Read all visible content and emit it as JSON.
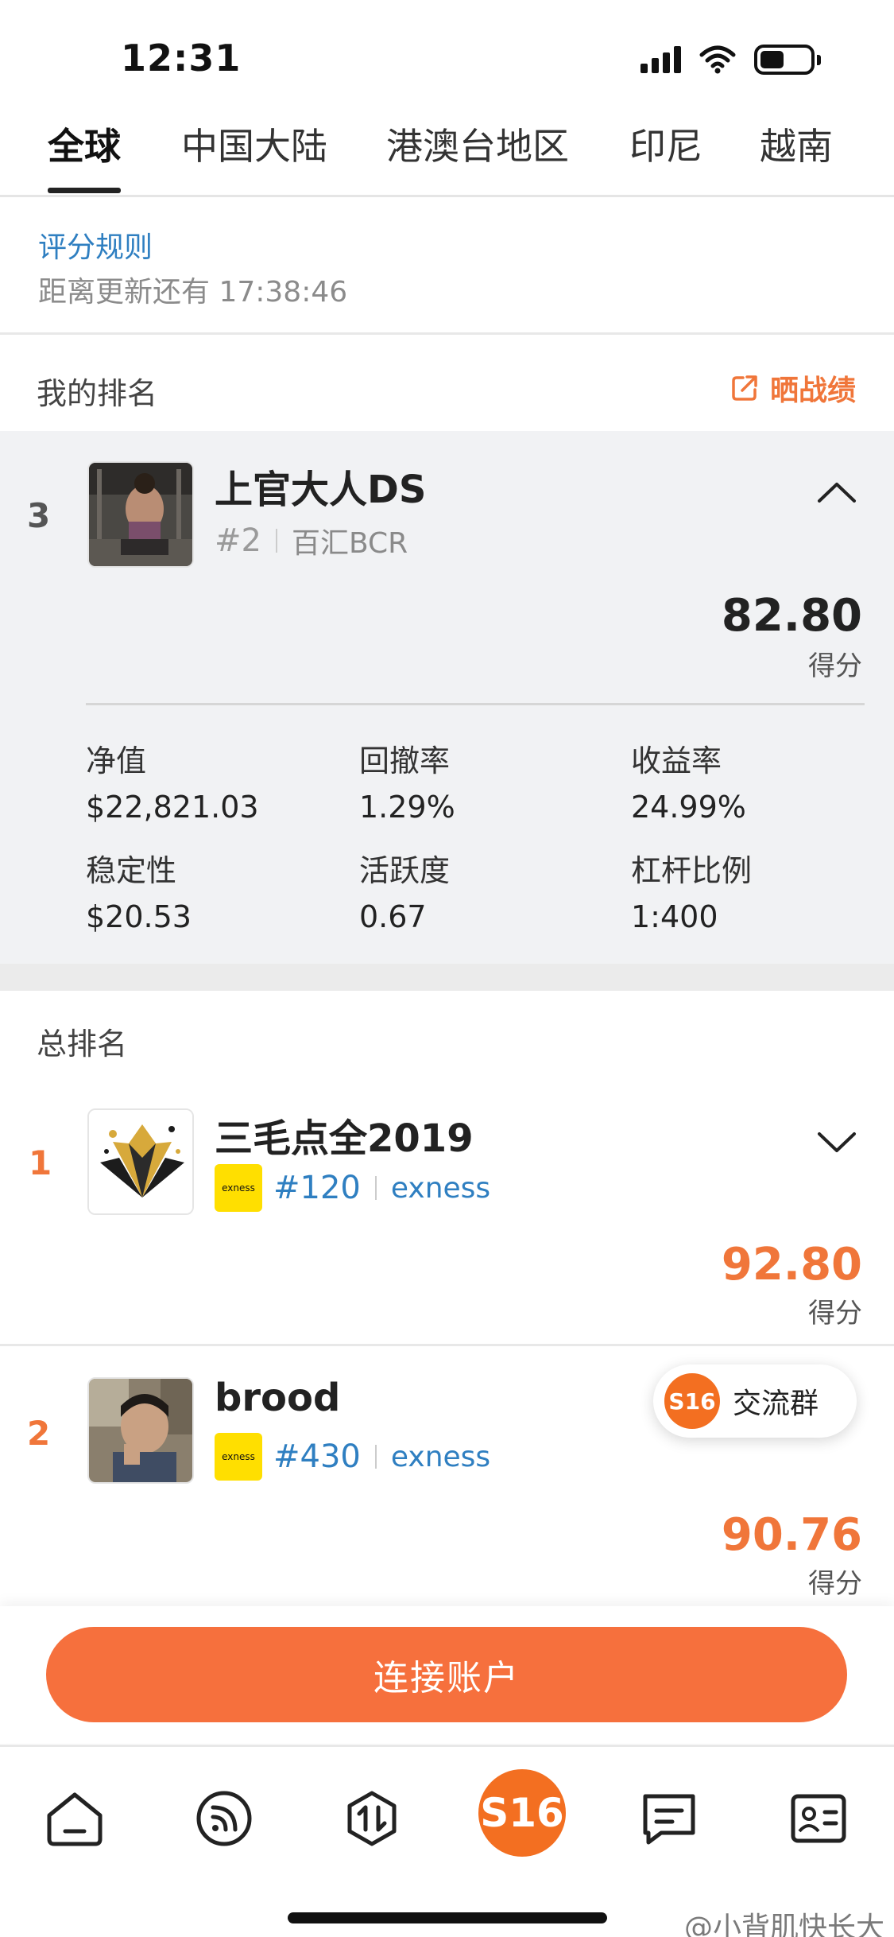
{
  "status_bar": {
    "time": "12:31"
  },
  "tabs": [
    {
      "label": "全球",
      "active": true
    },
    {
      "label": "中国大陆",
      "active": false
    },
    {
      "label": "港澳台地区",
      "active": false
    },
    {
      "label": "印尼",
      "active": false
    },
    {
      "label": "越南",
      "active": false
    }
  ],
  "rules": {
    "link": "评分规则",
    "countdown_prefix": "距离更新还有",
    "countdown": "17:38:46"
  },
  "my_rank": {
    "section_title": "我的排名",
    "share_label": "晒战绩",
    "rank": "3",
    "name": "上官大人DS",
    "account_no": "#2",
    "broker": "百汇BCR",
    "score": "82.80",
    "score_label": "得分",
    "stats": [
      {
        "label": "净值",
        "value": "$22,821.03"
      },
      {
        "label": "回撤率",
        "value": "1.29%"
      },
      {
        "label": "收益率",
        "value": "24.99%"
      },
      {
        "label": "稳定性",
        "value": "$20.53"
      },
      {
        "label": "活跃度",
        "value": "0.67"
      },
      {
        "label": "杠杆比例",
        "value": "1:400"
      }
    ]
  },
  "overall": {
    "section_title": "总排名",
    "items": [
      {
        "rank": "1",
        "name": "三毛点全2019",
        "logo_text": "exness",
        "account_no": "#120",
        "broker": "exness",
        "score": "92.80",
        "score_label": "得分"
      },
      {
        "rank": "2",
        "name": "brood",
        "logo_text": "exness",
        "account_no": "#430",
        "broker": "exness",
        "score": "90.76",
        "score_label": "得分"
      }
    ]
  },
  "group_chip": {
    "badge": "S16",
    "label": "交流群"
  },
  "connect_button": "连接账户",
  "bottom_nav": {
    "center_label": "S16",
    "items": [
      "home-icon",
      "feed-icon",
      "trade-icon",
      "s16-icon",
      "message-icon",
      "profile-card-icon"
    ]
  },
  "watermark": "@小背肌快长大",
  "colors": {
    "accent": "#f36f21",
    "link": "#2f7fc1",
    "score": "#f0763a",
    "card_bg": "#f1f2f4"
  }
}
